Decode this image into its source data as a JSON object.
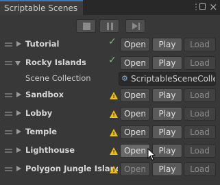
{
  "window": {
    "title": "Scriptable Scenes"
  },
  "toolbar": {
    "stop_icon": "stop-icon",
    "pause_icon": "pause-icon",
    "step_icon": "step-icon"
  },
  "scenes": [
    {
      "name": "Tutorial",
      "status": "check",
      "open": "Open",
      "play": "Play",
      "load": "Load",
      "expanded": false
    },
    {
      "name": "Rocky Islands",
      "status": "check",
      "open": "Open",
      "play": "Play",
      "load": "Load",
      "expanded": true,
      "sub_label": "Scene Collection",
      "sub_value": "ScriptableSceneColle"
    },
    {
      "name": "Sandbox",
      "status": "warning",
      "open": "Open",
      "play": "Play",
      "load": "Load"
    },
    {
      "name": "Lobby",
      "status": "warning",
      "open": "Open",
      "play": "Play",
      "load": "Load"
    },
    {
      "name": "Temple",
      "status": "warning",
      "open": "Open",
      "play": "Play",
      "load": "Load"
    },
    {
      "name": "Lighthouse",
      "status": "warning",
      "open": "Open",
      "play": "Play",
      "load": "Load"
    },
    {
      "name": "Polygon Jungle Island",
      "status": "warning",
      "open": "Open",
      "play": "Play",
      "load": "Load"
    }
  ]
}
